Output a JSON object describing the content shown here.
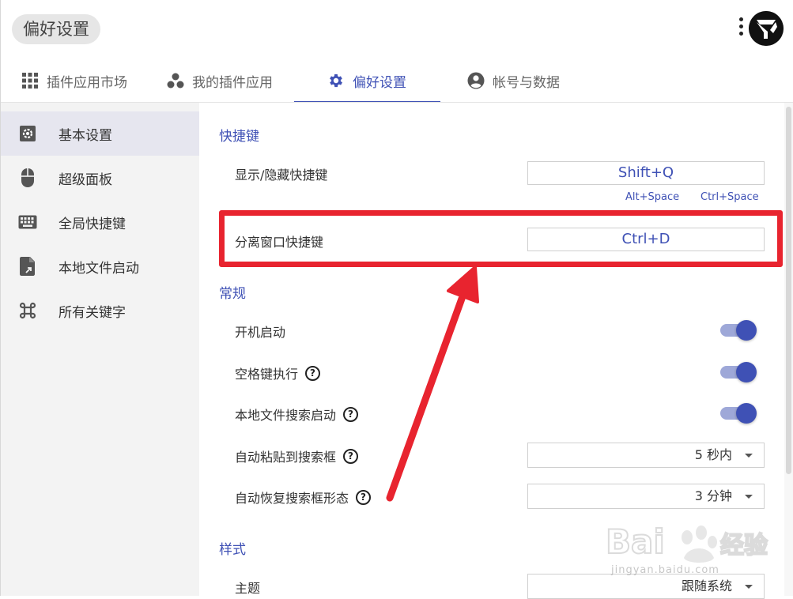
{
  "header": {
    "title": "偏好设置",
    "tabs": [
      {
        "label": "插件应用市场",
        "icon": "grid-icon"
      },
      {
        "label": "我的插件应用",
        "icon": "dots-cluster-icon"
      },
      {
        "label": "偏好设置",
        "icon": "gear-icon",
        "active": true
      },
      {
        "label": "帐号与数据",
        "icon": "account-circle-icon"
      }
    ]
  },
  "sidebar": {
    "items": [
      {
        "label": "基本设置",
        "icon": "settings-box-icon",
        "active": true
      },
      {
        "label": "超级面板",
        "icon": "mouse-icon"
      },
      {
        "label": "全局快捷键",
        "icon": "keyboard-icon"
      },
      {
        "label": "本地文件启动",
        "icon": "file-arrow-icon"
      },
      {
        "label": "所有关键字",
        "icon": "command-icon"
      }
    ]
  },
  "main": {
    "shortcuts": {
      "title": "快捷键",
      "show_hide_label": "显示/隐藏快捷键",
      "show_hide_value": "Shift+Q",
      "hint_alt": "Alt+Space",
      "hint_ctrl": "Ctrl+Space",
      "detach_label": "分离窗口快捷键",
      "detach_value": "Ctrl+D"
    },
    "general": {
      "title": "常规",
      "autostart_label": "开机启动",
      "autostart_on": true,
      "space_exec_label": "空格键执行",
      "space_exec_on": true,
      "local_search_label": "本地文件搜索启动",
      "local_search_on": true,
      "auto_paste_label": "自动粘贴到搜索框",
      "auto_paste_value": "5 秒内",
      "auto_restore_label": "自动恢复搜索框形态",
      "auto_restore_value": "3 分钟"
    },
    "style": {
      "title": "样式",
      "theme_label": "主题",
      "theme_value": "跟随系统"
    }
  },
  "watermark": {
    "url": "jingyan.baidu.com"
  },
  "colors": {
    "accent": "#3f51b5",
    "annotation_red": "#e8242f",
    "sidebar_bg": "#f3f3f3",
    "sidebar_active": "#e6e6ef"
  }
}
